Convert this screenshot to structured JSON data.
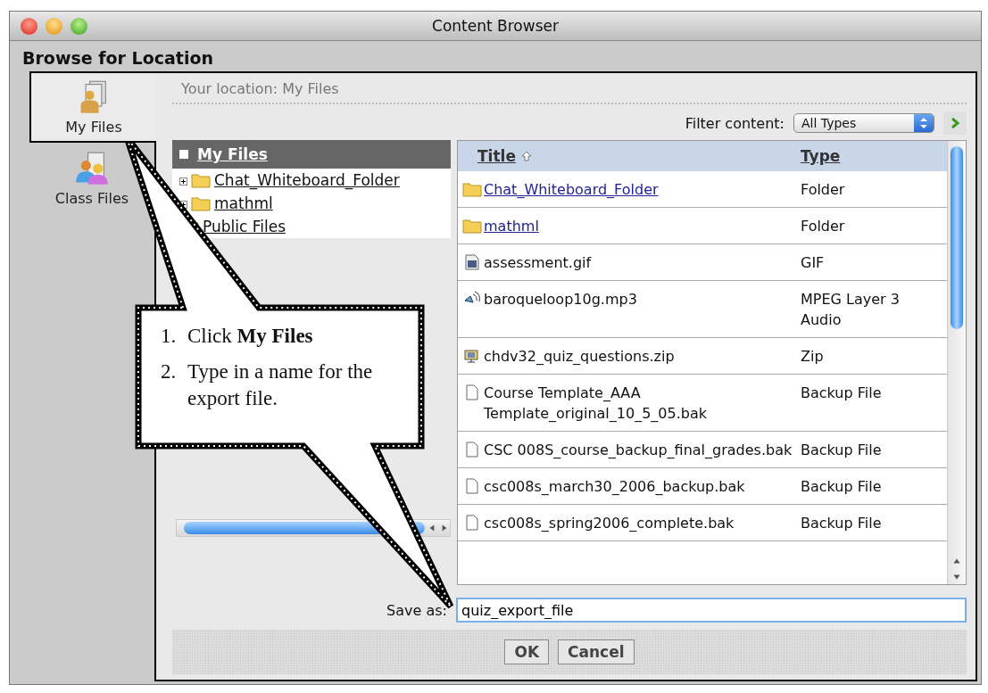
{
  "window": {
    "title": "Content Browser"
  },
  "heading": "Browse for Location",
  "sidebar": {
    "items": [
      {
        "label": "My Files",
        "selected": true,
        "kind": "person"
      },
      {
        "label": "Class Files",
        "selected": false,
        "kind": "group"
      }
    ]
  },
  "location": "Your location: My Files",
  "filter": {
    "label": "Filter content:",
    "value": "All Types"
  },
  "tree": {
    "root": "My Files",
    "children": [
      {
        "label": "Chat_Whiteboard_Folder",
        "expanded": false
      },
      {
        "label": "mathml",
        "expanded": false
      },
      {
        "label": "Public Files"
      }
    ]
  },
  "table": {
    "columns": [
      "Title",
      "Type"
    ],
    "rows": [
      {
        "title": "Chat_Whiteboard_Folder",
        "type": "Folder",
        "kind": "folder"
      },
      {
        "title": "mathml",
        "type": "Folder",
        "kind": "folder"
      },
      {
        "title": "assessment.gif",
        "type": "GIF",
        "kind": "image"
      },
      {
        "title": "baroqueloop10g.mp3",
        "type": "MPEG Layer 3 Audio",
        "kind": "audio"
      },
      {
        "title": "chdv32_quiz_questions.zip",
        "type": "Zip",
        "kind": "archive"
      },
      {
        "title": "Course Template_AAA Template_original_10_5_05.bak",
        "type": "Backup File",
        "kind": "file"
      },
      {
        "title": "CSC 008S_course_backup_final_grades.bak",
        "type": "Backup File",
        "kind": "file"
      },
      {
        "title": "csc008s_march30_2006_backup.bak",
        "type": "Backup File",
        "kind": "file"
      },
      {
        "title": "csc008s_spring2006_complete.bak",
        "type": "Backup File",
        "kind": "file"
      }
    ]
  },
  "save_as": {
    "label": "Save as:",
    "value": "quiz_export_file"
  },
  "buttons": [
    "OK",
    "Cancel"
  ],
  "callout": {
    "steps": [
      {
        "number": "1.",
        "text": "Click **My Files**"
      },
      {
        "number": "2.",
        "text": "Type in a name for the export file."
      }
    ]
  }
}
